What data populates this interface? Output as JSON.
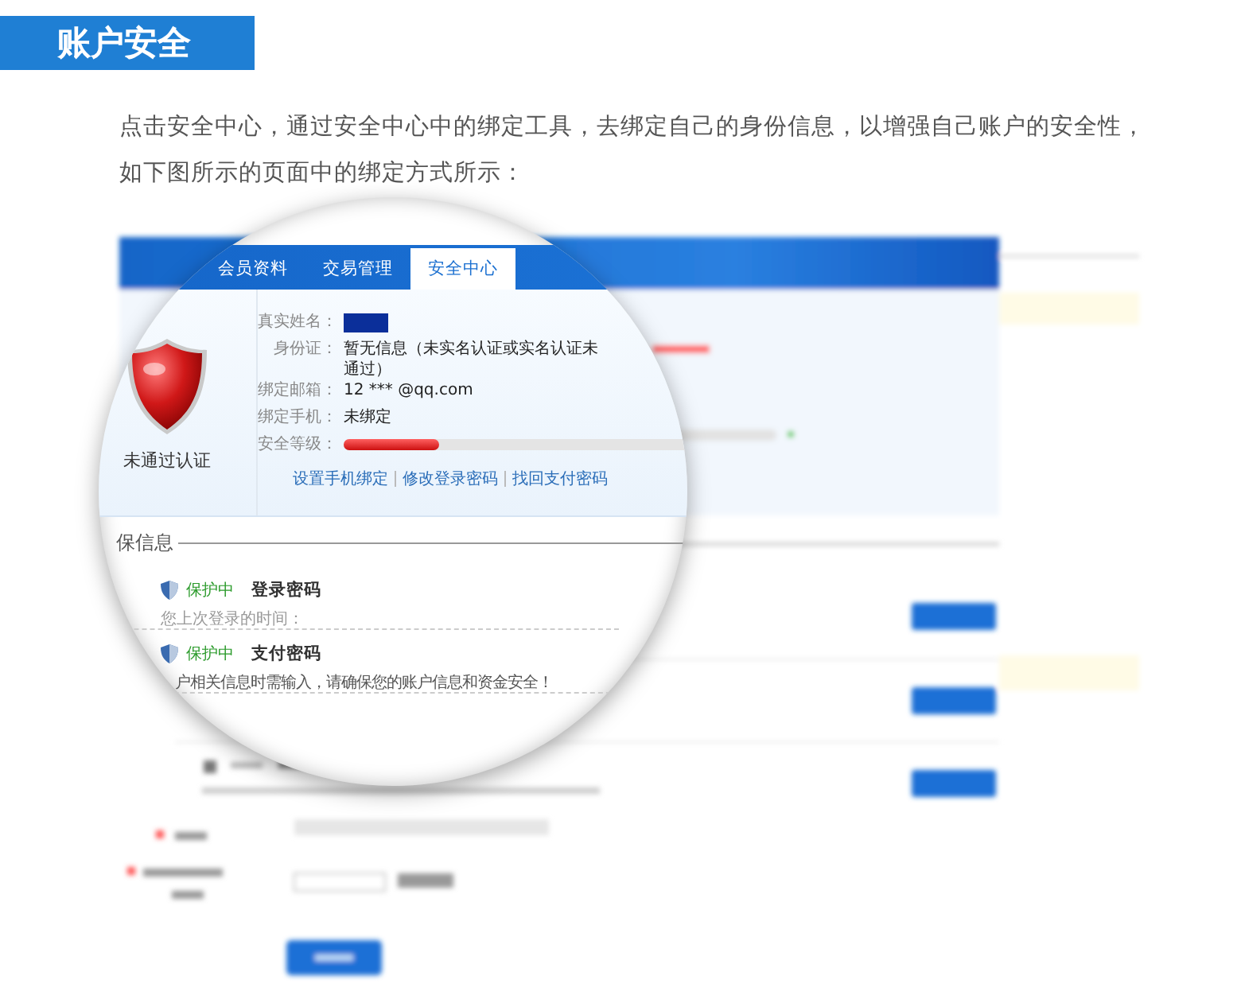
{
  "header": {
    "title": "账户安全"
  },
  "intro": "点击安全中心，通过安全中心中的绑定工具，去绑定自己的身份信息，以增强自己账户的安全性，如下图所示的页面中的绑定方式所示：",
  "screenshot": {
    "tabs": [
      {
        "label": "会员资料",
        "selected": false
      },
      {
        "label": "交易管理",
        "selected": false
      },
      {
        "label": "安全中心",
        "selected": true
      }
    ],
    "status": "未通过认证",
    "fields": [
      {
        "label": "真实姓名：",
        "kind": "masked"
      },
      {
        "label": "身份证：",
        "kind": "text",
        "value": "暂无信息（未实名认证或实名认证未通过）"
      },
      {
        "label": "绑定邮箱：",
        "kind": "text",
        "value": "12 *** @qq.com"
      },
      {
        "label": "绑定手机：",
        "kind": "text",
        "value": "未绑定"
      },
      {
        "label": "安全等级：",
        "kind": "meter",
        "level": 0.26
      }
    ],
    "links": [
      "设置手机绑定",
      "修改登录密码",
      "找回支付密码"
    ],
    "section_title": "保信息",
    "items": [
      {
        "status": "保护中",
        "name": "登录密码",
        "note": "您上次登录的时间："
      },
      {
        "status": "保护中",
        "name": "支付密码",
        "note": "户相关信息时需输入，请确保您的账户信息和资金安全！"
      }
    ]
  }
}
